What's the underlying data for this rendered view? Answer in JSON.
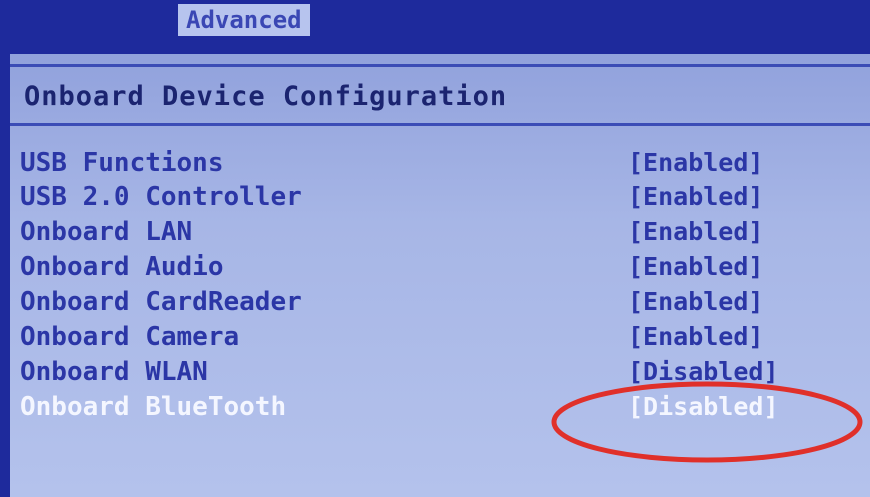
{
  "header": {
    "tab_label": "Advanced"
  },
  "page": {
    "title": "Onboard Device Configuration"
  },
  "settings": [
    {
      "label": "USB Functions",
      "value": "[Enabled]"
    },
    {
      "label": "USB 2.0 Controller",
      "value": "[Enabled]"
    },
    {
      "label": "Onboard LAN",
      "value": "[Enabled]"
    },
    {
      "label": "Onboard Audio",
      "value": "[Enabled]"
    },
    {
      "label": "Onboard CardReader",
      "value": "[Enabled]"
    },
    {
      "label": "Onboard Camera",
      "value": "[Enabled]"
    },
    {
      "label": "Onboard WLAN",
      "value": "[Disabled]"
    },
    {
      "label": "Onboard BlueTooth",
      "value": "[Disabled]"
    }
  ],
  "selected_setting": "Onboard BlueTooth",
  "colors": {
    "title_bar": "#1e2a9c",
    "panel_background": "#a7b6e6",
    "text": "#2b36a6",
    "selected_text": "#f4f6ff",
    "annotation_ellipse": "#e0302a"
  }
}
